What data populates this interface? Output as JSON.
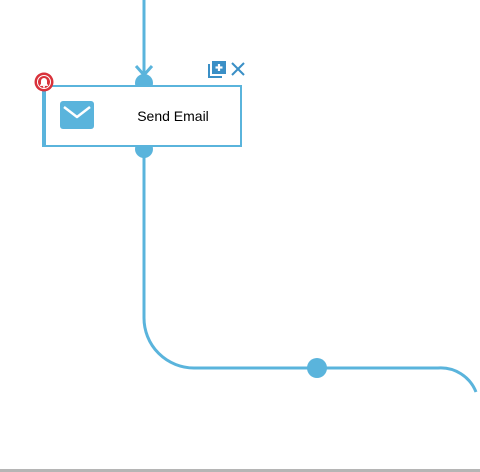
{
  "node": {
    "label": "Send Email",
    "icon": "envelope-icon",
    "badge_icon": "alert-bell-icon",
    "actions": [
      {
        "name": "add-node-button",
        "icon": "add-copy-icon"
      },
      {
        "name": "delete-node-button",
        "icon": "close-icon"
      }
    ]
  },
  "colors": {
    "connector": "#5ab4dc",
    "node_border": "#5ab4dc",
    "badge": "#d9323b",
    "action": "#3a8fc6"
  }
}
